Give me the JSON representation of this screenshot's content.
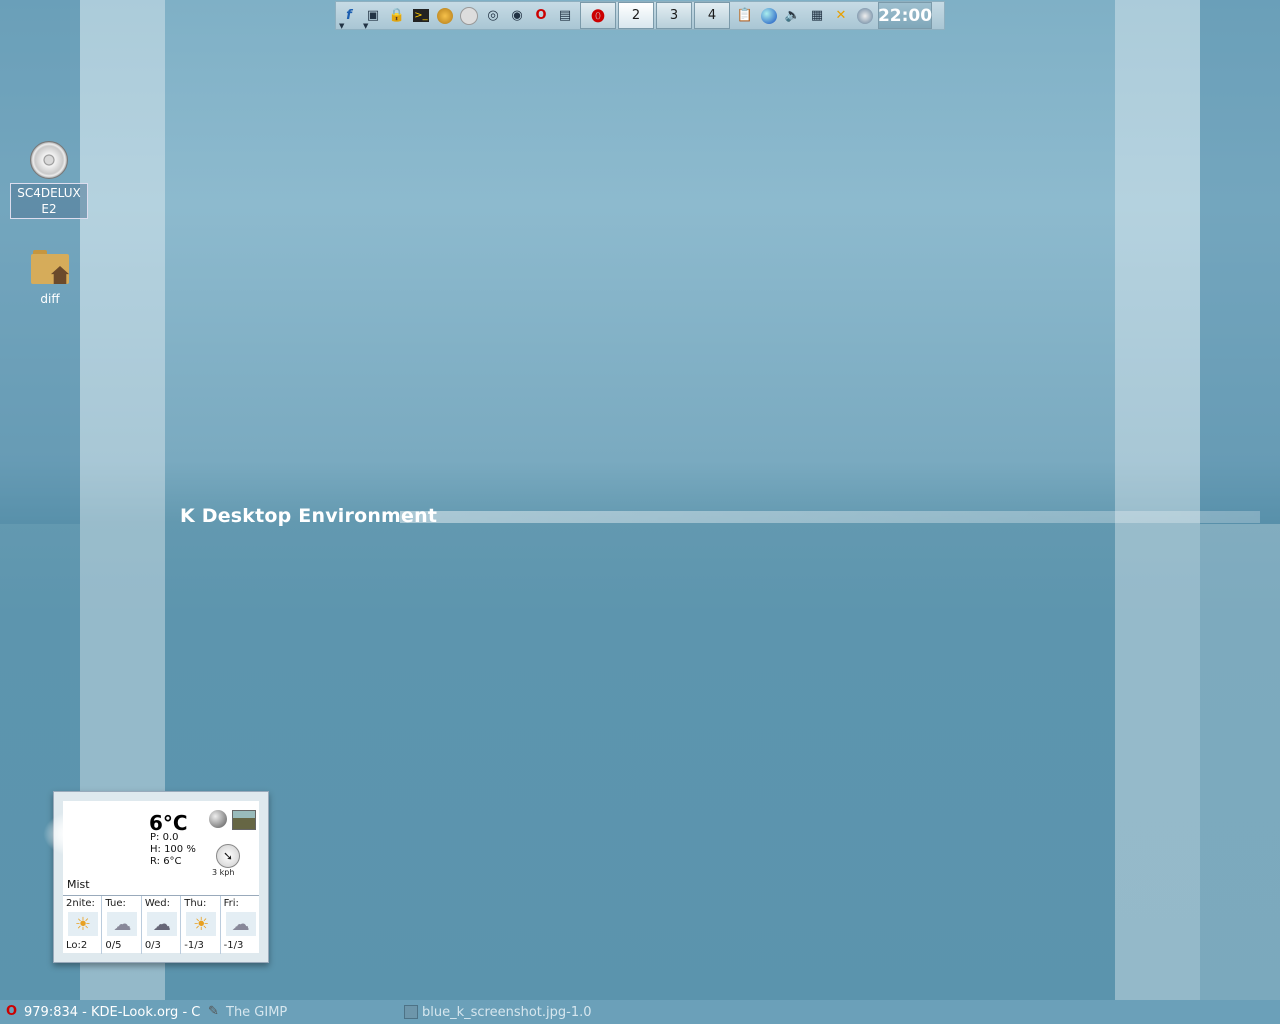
{
  "wallpaper": {
    "title": "K Desktop Environment"
  },
  "panel": {
    "launchers": [
      {
        "icon": "kde-menu-icon"
      },
      {
        "icon": "window-list-icon"
      },
      {
        "icon": "lock-icon"
      },
      {
        "icon": "terminal-icon"
      },
      {
        "icon": "paint-icon"
      },
      {
        "icon": "blank-icon"
      },
      {
        "icon": "binoculars-icon"
      },
      {
        "icon": "network-icon"
      },
      {
        "icon": "opera-icon"
      },
      {
        "icon": "presentation-icon"
      }
    ],
    "desktops": [
      "",
      "2",
      "3",
      "4"
    ],
    "active_desktop": 1,
    "tray": [
      {
        "icon": "clipboard-icon"
      },
      {
        "icon": "globe-icon"
      },
      {
        "icon": "speaker-icon"
      },
      {
        "icon": "network-monitor-icon"
      },
      {
        "icon": "tools-icon"
      },
      {
        "icon": "satellite-icon"
      }
    ],
    "clock": "22:00"
  },
  "desktop_icons": [
    {
      "label": "SC4DELUX E2",
      "icon": "cdrom-icon"
    },
    {
      "label": "diff",
      "icon": "home-folder-icon"
    }
  ],
  "weather": {
    "temperature": "6°C",
    "pressure": "P: 0.0",
    "humidity": "H: 100 %",
    "real_feel": "R: 6°C",
    "wind": "3 kph",
    "condition": "Mist",
    "forecast": [
      {
        "day": "2nite:",
        "temp": "Lo:2",
        "icon": "partly-cloudy-icon"
      },
      {
        "day": "Tue:",
        "temp": "0/5",
        "icon": "snow-icon"
      },
      {
        "day": "Wed:",
        "temp": "0/3",
        "icon": "snow-icon"
      },
      {
        "day": "Thu:",
        "temp": "-1/3",
        "icon": "partly-cloudy-icon"
      },
      {
        "day": "Fri:",
        "temp": "-1/3",
        "icon": "snow-icon"
      }
    ]
  },
  "taskbar": {
    "tasks": [
      {
        "label": "979:834 - KDE-Look.org - C",
        "icon": "opera-icon"
      },
      {
        "label": "The GIMP",
        "icon": "gimp-icon"
      },
      {
        "label": "blue_k_screenshot.jpg-1.0",
        "icon": "image-icon"
      }
    ]
  }
}
